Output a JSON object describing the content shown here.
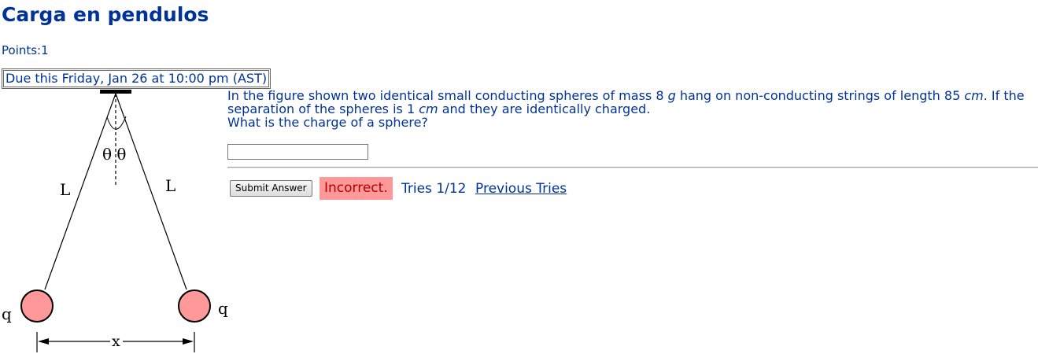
{
  "page": {
    "title": "Carga en pendulos",
    "points": "Points:1",
    "due": "Due this Friday, Jan 26 at 10:00 pm (AST)"
  },
  "question": {
    "line1_a": "In the figure shown two identical small conducting spheres of mass 8 ",
    "mass_unit": "g",
    "line1_b": " hang on non-conducting strings of length 85 ",
    "length_unit": "cm",
    "line1_c": ". If the separation of the spheres is 1 ",
    "sep_unit": "cm",
    "line1_d": " and they are identically charged.",
    "line2": "What is the charge of a sphere?"
  },
  "answer": {
    "value": ""
  },
  "actions": {
    "submit_label": "Submit Answer",
    "status": "Incorrect.",
    "tries": "Tries 1/12",
    "previous_tries": "Previous Tries"
  },
  "figure": {
    "label_theta": "θ θ",
    "label_L_left": "L",
    "label_L_right": "L",
    "label_q_left": "q",
    "label_q_right": "q",
    "label_x": "x",
    "sphere_color": "#ff9999"
  }
}
